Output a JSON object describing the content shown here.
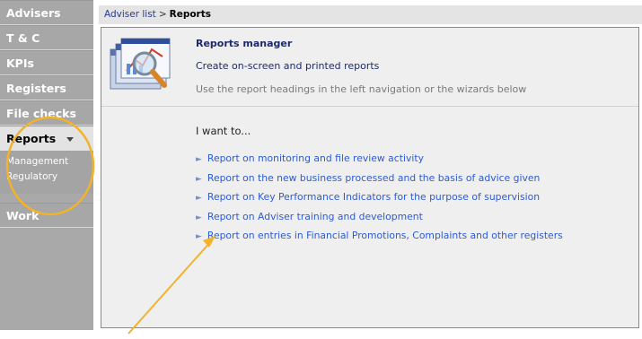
{
  "sidebar": {
    "items": [
      {
        "label": "Advisers"
      },
      {
        "label": "T & C"
      },
      {
        "label": "KPIs"
      },
      {
        "label": "Registers"
      },
      {
        "label": "File checks"
      },
      {
        "label": "Reports"
      }
    ],
    "sub_items": [
      {
        "label": "Management"
      },
      {
        "label": "Regulatory"
      }
    ],
    "after": {
      "label": "Work"
    }
  },
  "breadcrumb": {
    "parent": "Adviser list",
    "separator": ">",
    "current": "Reports"
  },
  "hero": {
    "title": "Reports manager",
    "subtitle": "Create on-screen and printed reports",
    "note": "Use the report headings in the left navigation or the wizards below",
    "icon": "reports-magnifier-icon"
  },
  "main": {
    "heading": "I want to...",
    "links": [
      {
        "label": "Report on monitoring and file review activity"
      },
      {
        "label": "Report on the new business processed and the basis of advice given"
      },
      {
        "label": "Report on Key Performance Indicators for the purpose of supervision"
      },
      {
        "label": "Report on Adviser training and development"
      },
      {
        "label": "Report on entries in Financial Promotions, Complaints and other registers"
      }
    ]
  },
  "colors": {
    "annotation": "#f3b22a",
    "link": "#2d5bd4",
    "sidebar": "#a9a9a9",
    "title": "#1b2a6e"
  }
}
